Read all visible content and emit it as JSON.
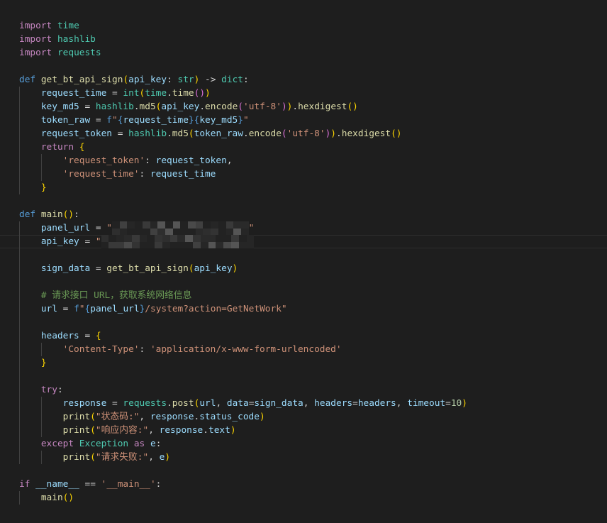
{
  "editor": {
    "current_line_index": 16,
    "colors": {
      "background": "#1e1e1e",
      "plain": "#d4d4d4",
      "keyword": "#c586c0",
      "storage": "#569cd6",
      "function": "#dcdcaa",
      "type": "#4ec9b0",
      "variable": "#9cdcfe",
      "string": "#ce9178",
      "number": "#b5cea8",
      "comment": "#6a9955",
      "bracket1": "#ffd700",
      "bracket2": "#da70d6",
      "indent_guide": "#404040",
      "line_highlight_border": "#2e2e2e"
    },
    "lines": [
      {
        "indent": 0,
        "tokens": [
          {
            "t": "import",
            "c": "keyword"
          },
          {
            "t": " "
          },
          {
            "t": "time",
            "c": "type"
          }
        ]
      },
      {
        "indent": 0,
        "tokens": [
          {
            "t": "import",
            "c": "keyword"
          },
          {
            "t": " "
          },
          {
            "t": "hashlib",
            "c": "type"
          }
        ]
      },
      {
        "indent": 0,
        "tokens": [
          {
            "t": "import",
            "c": "keyword"
          },
          {
            "t": " "
          },
          {
            "t": "requests",
            "c": "type"
          }
        ]
      },
      {
        "indent": 0,
        "tokens": []
      },
      {
        "indent": 0,
        "tokens": [
          {
            "t": "def",
            "c": "storage"
          },
          {
            "t": " "
          },
          {
            "t": "get_bt_api_sign",
            "c": "function"
          },
          {
            "t": "(",
            "c": "bracket1"
          },
          {
            "t": "api_key",
            "c": "variable"
          },
          {
            "t": ": "
          },
          {
            "t": "str",
            "c": "type"
          },
          {
            "t": ")",
            "c": "bracket1"
          },
          {
            "t": " -> "
          },
          {
            "t": "dict",
            "c": "type"
          },
          {
            "t": ":"
          }
        ]
      },
      {
        "indent": 4,
        "tokens": [
          {
            "t": "request_time",
            "c": "variable"
          },
          {
            "t": " = "
          },
          {
            "t": "int",
            "c": "type"
          },
          {
            "t": "(",
            "c": "bracket1"
          },
          {
            "t": "time",
            "c": "type"
          },
          {
            "t": "."
          },
          {
            "t": "time",
            "c": "function"
          },
          {
            "t": "()",
            "c": "bracket2"
          },
          {
            "t": ")",
            "c": "bracket1"
          }
        ]
      },
      {
        "indent": 4,
        "tokens": [
          {
            "t": "key_md5",
            "c": "variable"
          },
          {
            "t": " = "
          },
          {
            "t": "hashlib",
            "c": "type"
          },
          {
            "t": "."
          },
          {
            "t": "md5",
            "c": "function"
          },
          {
            "t": "(",
            "c": "bracket1"
          },
          {
            "t": "api_key",
            "c": "variable"
          },
          {
            "t": "."
          },
          {
            "t": "encode",
            "c": "function"
          },
          {
            "t": "(",
            "c": "bracket2"
          },
          {
            "t": "'utf-8'",
            "c": "string"
          },
          {
            "t": ")",
            "c": "bracket2"
          },
          {
            "t": ")",
            "c": "bracket1"
          },
          {
            "t": "."
          },
          {
            "t": "hexdigest",
            "c": "function"
          },
          {
            "t": "()",
            "c": "bracket1"
          }
        ]
      },
      {
        "indent": 4,
        "tokens": [
          {
            "t": "token_raw",
            "c": "variable"
          },
          {
            "t": " = "
          },
          {
            "t": "f",
            "c": "storage"
          },
          {
            "t": "\"",
            "c": "string"
          },
          {
            "t": "{",
            "c": "storage"
          },
          {
            "t": "request_time",
            "c": "variable"
          },
          {
            "t": "}{",
            "c": "storage"
          },
          {
            "t": "key_md5",
            "c": "variable"
          },
          {
            "t": "}",
            "c": "storage"
          },
          {
            "t": "\"",
            "c": "string"
          }
        ]
      },
      {
        "indent": 4,
        "tokens": [
          {
            "t": "request_token",
            "c": "variable"
          },
          {
            "t": " = "
          },
          {
            "t": "hashlib",
            "c": "type"
          },
          {
            "t": "."
          },
          {
            "t": "md5",
            "c": "function"
          },
          {
            "t": "(",
            "c": "bracket1"
          },
          {
            "t": "token_raw",
            "c": "variable"
          },
          {
            "t": "."
          },
          {
            "t": "encode",
            "c": "function"
          },
          {
            "t": "(",
            "c": "bracket2"
          },
          {
            "t": "'utf-8'",
            "c": "string"
          },
          {
            "t": ")",
            "c": "bracket2"
          },
          {
            "t": ")",
            "c": "bracket1"
          },
          {
            "t": "."
          },
          {
            "t": "hexdigest",
            "c": "function"
          },
          {
            "t": "()",
            "c": "bracket1"
          }
        ]
      },
      {
        "indent": 4,
        "tokens": [
          {
            "t": "return",
            "c": "keyword"
          },
          {
            "t": " "
          },
          {
            "t": "{",
            "c": "bracket1"
          }
        ]
      },
      {
        "indent": 8,
        "tokens": [
          {
            "t": "'request_token'",
            "c": "string"
          },
          {
            "t": ": "
          },
          {
            "t": "request_token",
            "c": "variable"
          },
          {
            "t": ","
          }
        ]
      },
      {
        "indent": 8,
        "tokens": [
          {
            "t": "'request_time'",
            "c": "string"
          },
          {
            "t": ": "
          },
          {
            "t": "request_time",
            "c": "variable"
          }
        ]
      },
      {
        "indent": 4,
        "tokens": [
          {
            "t": "}",
            "c": "bracket1"
          }
        ]
      },
      {
        "indent": 0,
        "tokens": []
      },
      {
        "indent": 0,
        "tokens": [
          {
            "t": "def",
            "c": "storage"
          },
          {
            "t": " "
          },
          {
            "t": "main",
            "c": "function"
          },
          {
            "t": "()",
            "c": "bracket1"
          },
          {
            "t": ":"
          }
        ]
      },
      {
        "indent": 4,
        "tokens": [
          {
            "t": "panel_url",
            "c": "variable"
          },
          {
            "t": " = "
          },
          {
            "t": "\"",
            "c": "string"
          },
          {
            "c": "redacted"
          },
          {
            "t": "\"",
            "c": "string"
          }
        ]
      },
      {
        "indent": 4,
        "tokens": [
          {
            "t": "api_key",
            "c": "variable"
          },
          {
            "t": " = "
          },
          {
            "t": "\"",
            "c": "string"
          },
          {
            "c": "redacted"
          }
        ]
      },
      {
        "indent": 0,
        "tokens": []
      },
      {
        "indent": 4,
        "tokens": [
          {
            "t": "sign_data",
            "c": "variable"
          },
          {
            "t": " = "
          },
          {
            "t": "get_bt_api_sign",
            "c": "function"
          },
          {
            "t": "(",
            "c": "bracket1"
          },
          {
            "t": "api_key",
            "c": "variable"
          },
          {
            "t": ")",
            "c": "bracket1"
          }
        ]
      },
      {
        "indent": 0,
        "tokens": []
      },
      {
        "indent": 4,
        "tokens": [
          {
            "t": "# 请求接口 URL，获取系统网络信息",
            "c": "comment"
          }
        ]
      },
      {
        "indent": 4,
        "tokens": [
          {
            "t": "url",
            "c": "variable"
          },
          {
            "t": " = "
          },
          {
            "t": "f",
            "c": "storage"
          },
          {
            "t": "\"",
            "c": "string"
          },
          {
            "t": "{",
            "c": "storage"
          },
          {
            "t": "panel_url",
            "c": "variable"
          },
          {
            "t": "}",
            "c": "storage"
          },
          {
            "t": "/system?action=GetNetWork\"",
            "c": "string"
          }
        ]
      },
      {
        "indent": 0,
        "tokens": []
      },
      {
        "indent": 4,
        "tokens": [
          {
            "t": "headers",
            "c": "variable"
          },
          {
            "t": " = "
          },
          {
            "t": "{",
            "c": "bracket1"
          }
        ]
      },
      {
        "indent": 8,
        "tokens": [
          {
            "t": "'Content-Type'",
            "c": "string"
          },
          {
            "t": ": "
          },
          {
            "t": "'application/x-www-form-urlencoded'",
            "c": "string"
          }
        ]
      },
      {
        "indent": 4,
        "tokens": [
          {
            "t": "}",
            "c": "bracket1"
          }
        ]
      },
      {
        "indent": 0,
        "tokens": []
      },
      {
        "indent": 4,
        "tokens": [
          {
            "t": "try",
            "c": "keyword"
          },
          {
            "t": ":"
          }
        ]
      },
      {
        "indent": 8,
        "tokens": [
          {
            "t": "response",
            "c": "variable"
          },
          {
            "t": " = "
          },
          {
            "t": "requests",
            "c": "type"
          },
          {
            "t": "."
          },
          {
            "t": "post",
            "c": "function"
          },
          {
            "t": "(",
            "c": "bracket1"
          },
          {
            "t": "url",
            "c": "variable"
          },
          {
            "t": ", "
          },
          {
            "t": "data",
            "c": "variable"
          },
          {
            "t": "="
          },
          {
            "t": "sign_data",
            "c": "variable"
          },
          {
            "t": ", "
          },
          {
            "t": "headers",
            "c": "variable"
          },
          {
            "t": "="
          },
          {
            "t": "headers",
            "c": "variable"
          },
          {
            "t": ", "
          },
          {
            "t": "timeout",
            "c": "variable"
          },
          {
            "t": "="
          },
          {
            "t": "10",
            "c": "number"
          },
          {
            "t": ")",
            "c": "bracket1"
          }
        ]
      },
      {
        "indent": 8,
        "tokens": [
          {
            "t": "print",
            "c": "function"
          },
          {
            "t": "(",
            "c": "bracket1"
          },
          {
            "t": "\"状态码:\"",
            "c": "string"
          },
          {
            "t": ", "
          },
          {
            "t": "response",
            "c": "variable"
          },
          {
            "t": "."
          },
          {
            "t": "status_code",
            "c": "variable"
          },
          {
            "t": ")",
            "c": "bracket1"
          }
        ]
      },
      {
        "indent": 8,
        "tokens": [
          {
            "t": "print",
            "c": "function"
          },
          {
            "t": "(",
            "c": "bracket1"
          },
          {
            "t": "\"响应内容:\"",
            "c": "string"
          },
          {
            "t": ", "
          },
          {
            "t": "response",
            "c": "variable"
          },
          {
            "t": "."
          },
          {
            "t": "text",
            "c": "variable"
          },
          {
            "t": ")",
            "c": "bracket1"
          }
        ]
      },
      {
        "indent": 4,
        "tokens": [
          {
            "t": "except",
            "c": "keyword"
          },
          {
            "t": " "
          },
          {
            "t": "Exception",
            "c": "type"
          },
          {
            "t": " "
          },
          {
            "t": "as",
            "c": "keyword"
          },
          {
            "t": " "
          },
          {
            "t": "e",
            "c": "variable"
          },
          {
            "t": ":"
          }
        ]
      },
      {
        "indent": 8,
        "tokens": [
          {
            "t": "print",
            "c": "function"
          },
          {
            "t": "(",
            "c": "bracket1"
          },
          {
            "t": "\"请求失败:\"",
            "c": "string"
          },
          {
            "t": ", "
          },
          {
            "t": "e",
            "c": "variable"
          },
          {
            "t": ")",
            "c": "bracket1"
          }
        ]
      },
      {
        "indent": 0,
        "tokens": []
      },
      {
        "indent": 0,
        "tokens": [
          {
            "t": "if",
            "c": "keyword"
          },
          {
            "t": " "
          },
          {
            "t": "__name__",
            "c": "variable"
          },
          {
            "t": " == "
          },
          {
            "t": "'__main__'",
            "c": "string"
          },
          {
            "t": ":"
          }
        ]
      },
      {
        "indent": 4,
        "tokens": [
          {
            "t": "main",
            "c": "function"
          },
          {
            "t": "()",
            "c": "bracket1"
          }
        ]
      }
    ]
  }
}
